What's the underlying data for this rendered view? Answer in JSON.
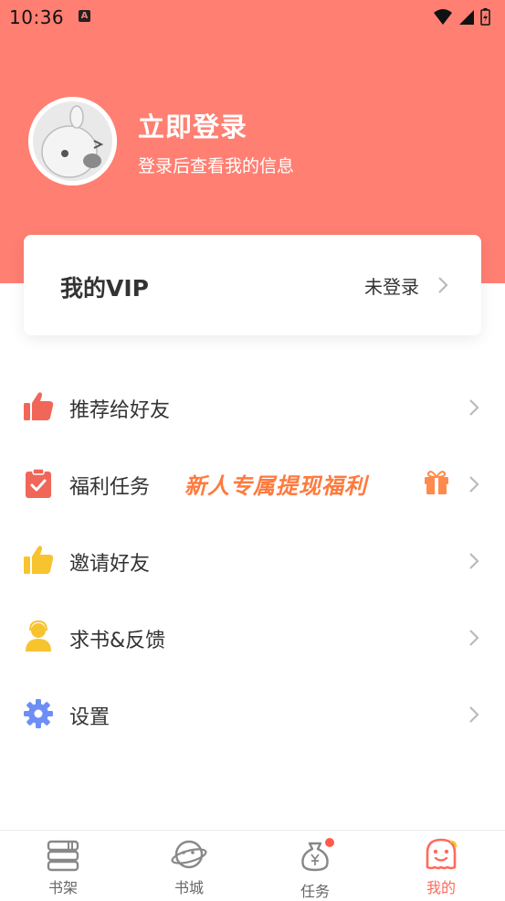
{
  "status_bar": {
    "time": "10:36",
    "app_icon_letter": "A"
  },
  "profile": {
    "title": "立即登录",
    "subtitle": "登录后查看我的信息"
  },
  "vip": {
    "title": "我的VIP",
    "status": "未登录"
  },
  "menu": [
    {
      "label": "推荐给好友",
      "icon": "thumbs-up-icon"
    },
    {
      "label": "福利任务",
      "icon": "clipboard-check-icon",
      "promo": "新人专属提现福利"
    },
    {
      "label": "邀请好友",
      "icon": "thumbs-up-icon"
    },
    {
      "label": "求书&反馈",
      "icon": "user-headset-icon"
    },
    {
      "label": "设置",
      "icon": "gear-icon"
    }
  ],
  "tabs": [
    {
      "label": "书架",
      "icon": "bookshelf-icon"
    },
    {
      "label": "书城",
      "icon": "planet-icon"
    },
    {
      "label": "任务",
      "icon": "money-bag-icon",
      "badge": true
    },
    {
      "label": "我的",
      "icon": "smile-face-icon",
      "active": true
    }
  ],
  "colors": {
    "brand": "#ff7f72",
    "promo": "#ff7a3d",
    "active_tab": "#ff6a5c",
    "thumbs_red": "#f0675a",
    "thumbs_yellow": "#f7c32f",
    "gear_blue": "#6d8ff5"
  }
}
